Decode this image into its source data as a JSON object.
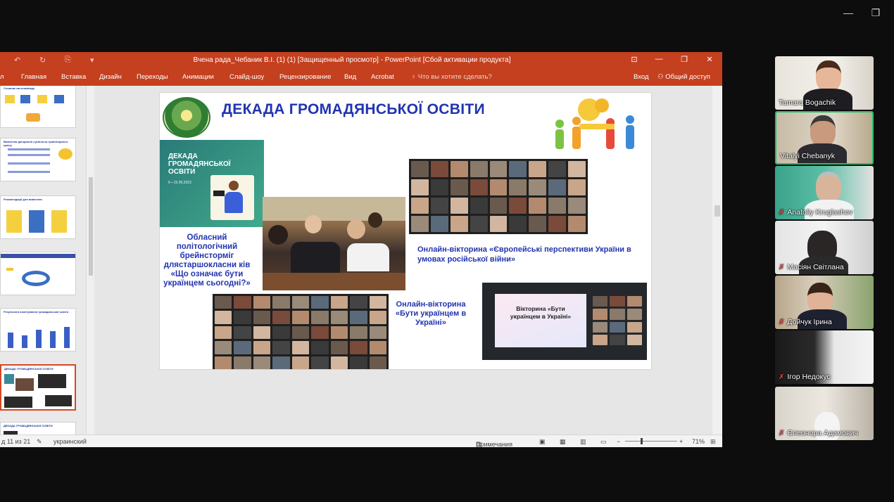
{
  "window_controls": {
    "minimize": "—",
    "restore": "❐"
  },
  "ppt": {
    "title": "Вчена рада_Чебаник В.І. (1) (1) [Защищенный просмотр] - PowerPoint [Сбой активации продукта]",
    "quick_access": {
      "undo": "↶",
      "redo": "↻",
      "save": "⎘",
      "more": "▾"
    },
    "win_buttons": {
      "ribbon_display": "⊡",
      "minimize": "—",
      "restore": "❐",
      "close": "✕"
    },
    "ribbon_tabs": [
      "л",
      "Главная",
      "Вставка",
      "Дизайн",
      "Переходы",
      "Анимации",
      "Слайд-шоу",
      "Рецензирование",
      "Вид",
      "Acrobat"
    ],
    "tell_me": "Что вы хотите сделать?",
    "sign_in": "Вход",
    "share": "Общий доступ",
    "status": {
      "slide_counter": "д 11 из 21",
      "language": "украинский",
      "notes": "Примечания",
      "zoom": "71%"
    }
  },
  "thumbs": [
    {
      "title": "Словник вв ксимінару"
    },
    {
      "title": "Вивчення дисциплін суспільно-гуманітарного циклу"
    },
    {
      "title": "Рекомендації для вивчення"
    },
    {
      "title": ""
    },
    {
      "title": "Результати анкетування громадянської освіти"
    },
    {
      "title": "ДЕКАДА ГРОМАДЯНСЬКОЇ ОСВІТИ"
    },
    {
      "title": "ДЕКАДА ГРОМАДЯНСЬКОЇ ОСВІТИ"
    }
  ],
  "slide": {
    "title": "ДЕКАДА ГРОМАДЯНСЬКОЇ ОСВІТИ",
    "poster_title": "ДЕКАДА ГРОМАДЯНСЬКОЇ ОСВІТИ",
    "poster_dates": "6—15.05.2023",
    "text_brainstorm": "Обласний політологічний брейнсторміг длястаршокласни ків «Що означає бути українцем сьогодні?»",
    "text_quiz_eu": "Онлайн-вікторина «Європейські перспективи України в умовах російської війни»",
    "text_quiz_ua": "Онлайн-вікторина «Бути українцем в Україні»",
    "quiz_card_text": "Вікторина «Бути українцем в Україні»"
  },
  "participants": [
    {
      "name": "Tamara Bogachik",
      "muted": false,
      "active": false
    },
    {
      "name": "Vitalyi Chebanyk",
      "muted": false,
      "active": true
    },
    {
      "name": "Anatoliy Kruglashov",
      "muted": true,
      "active": false
    },
    {
      "name": "Масіян Світлана",
      "muted": true,
      "active": false
    },
    {
      "name": "Дойчук Ірина",
      "muted": true,
      "active": false
    },
    {
      "name": "Ігор Недокус",
      "muted": true,
      "active": false
    },
    {
      "name": "Єлеонора Адамович",
      "muted": true,
      "active": false
    }
  ],
  "colors": {
    "ppt_accent": "#c4401f",
    "slide_title": "#2234b0",
    "active_speaker": "#1fc26b",
    "muted_mic": "#ff4a4a"
  }
}
